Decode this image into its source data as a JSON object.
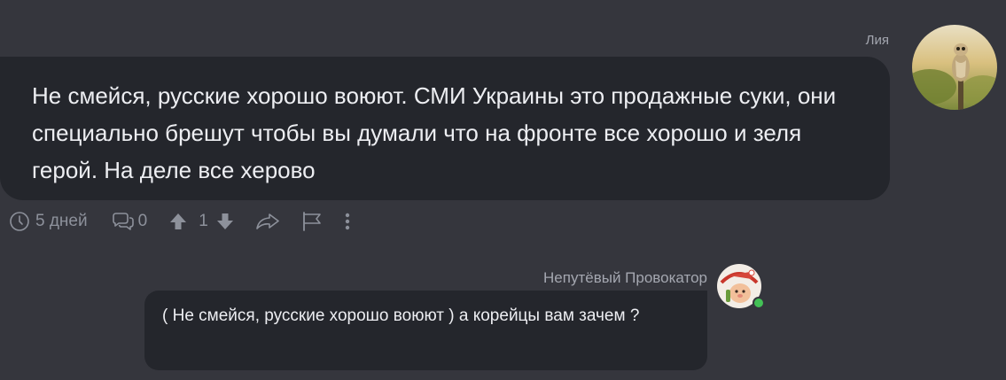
{
  "message1": {
    "author": "Лия",
    "text": "Не смейся, русские хорошо воюют. СМИ Украины это продажные суки, они специально брешут чтобы вы думали что на фронте все хорошо и зеля герой. На деле все херово",
    "avatar": "owl-photo-avatar",
    "actions": {
      "time": "5 дней",
      "replies_count": "0",
      "score": "1",
      "icons": [
        "clock-icon",
        "comment-icon",
        "upvote-icon",
        "downvote-icon",
        "share-icon",
        "flag-icon",
        "more-icon"
      ]
    }
  },
  "message2": {
    "author": "Непутёвый Провокатор",
    "text": "( Не смейся, русские хорошо воюют ) а корейцы вам зачем ?",
    "avatar": "sticker-avatar",
    "online": true
  },
  "colors": {
    "background": "#35363d",
    "bubble": "#24262c",
    "muted": "#8d919b",
    "online": "#43c156"
  }
}
